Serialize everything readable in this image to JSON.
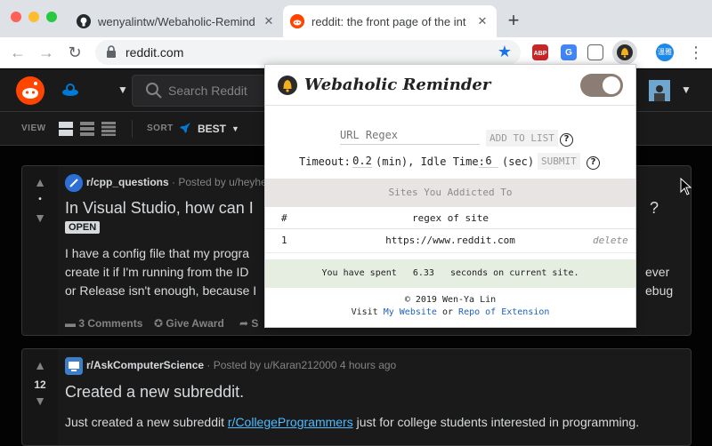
{
  "browser": {
    "tabs": [
      {
        "title": "wenyalintw/Webaholic-Remind",
        "favicon": "github-icon",
        "active": false
      },
      {
        "title": "reddit: the front page of the int",
        "favicon": "reddit-icon",
        "active": true
      }
    ],
    "new_tab": "+",
    "address": "reddit.com",
    "extensions": [
      {
        "name": "adblock-icon",
        "text": "ABP",
        "badge": "8"
      },
      {
        "name": "translate-icon",
        "text": "G"
      },
      {
        "name": "cast-icon",
        "text": ""
      },
      {
        "name": "webaholic-reminder-icon",
        "text": ""
      },
      {
        "name": "profile-icon",
        "text": "溫雅"
      }
    ]
  },
  "reddit": {
    "search_placeholder": "Search Reddit",
    "view_label": "VIEW",
    "sort_label": "SORT",
    "sort_value": "BEST",
    "posts": [
      {
        "subreddit": "r/cpp_questions",
        "posted_by": "· Posted by u/heyhe",
        "title_start": "In Visual Studio, how can I",
        "title_end": "?",
        "flair": "OPEN",
        "body_lines": [
          "I have a config file that my progra",
          "create it if I'm running from the ID",
          "or Release isn't enough, because I"
        ],
        "body_right": [
          "ever",
          "ebug"
        ],
        "vote_count": "",
        "actions": [
          "3 Comments",
          "Give Award",
          "S"
        ]
      },
      {
        "subreddit": "r/AskComputerScience",
        "posted_by": "· Posted by u/Karan212000 4 hours ago",
        "title": "Created a new subreddit.",
        "body_prefix": "Just created a new subreddit ",
        "body_link": "r/CollegeProgrammers",
        "body_suffix": " just for college students interested in programming.",
        "vote_count": "12"
      }
    ]
  },
  "popup": {
    "title": "Webaholic Reminder",
    "enabled": true,
    "url_regex_placeholder": "URL Regex",
    "add_button": "ADD TO LIST",
    "help": "?",
    "timeout_label": "Timeout:",
    "timeout_value": "0.2",
    "timeout_unit": "(min), Idle Time:",
    "idle_value": "6",
    "idle_unit": "(sec)",
    "submit_button": "SUBMIT",
    "sites_header": "Sites You Addicted To",
    "table_headers": [
      "#",
      "regex of site"
    ],
    "sites": [
      {
        "index": "1",
        "regex": "https://www.reddit.com",
        "action": "delete"
      }
    ],
    "spent_prefix": "You have spent",
    "spent_value": "6.33",
    "spent_suffix": "seconds on current site.",
    "copyright": "© 2019 Wen-Ya Lin",
    "visit": "Visit",
    "website_link": "My Website",
    "or": "or",
    "repo_link": "Repo of Extension"
  },
  "colors": {
    "reddit_orange": "#ff4500",
    "reddit_blue": "#0079d3",
    "toggle_on": "#8b7d73",
    "link_blue": "#1f5fbf"
  }
}
